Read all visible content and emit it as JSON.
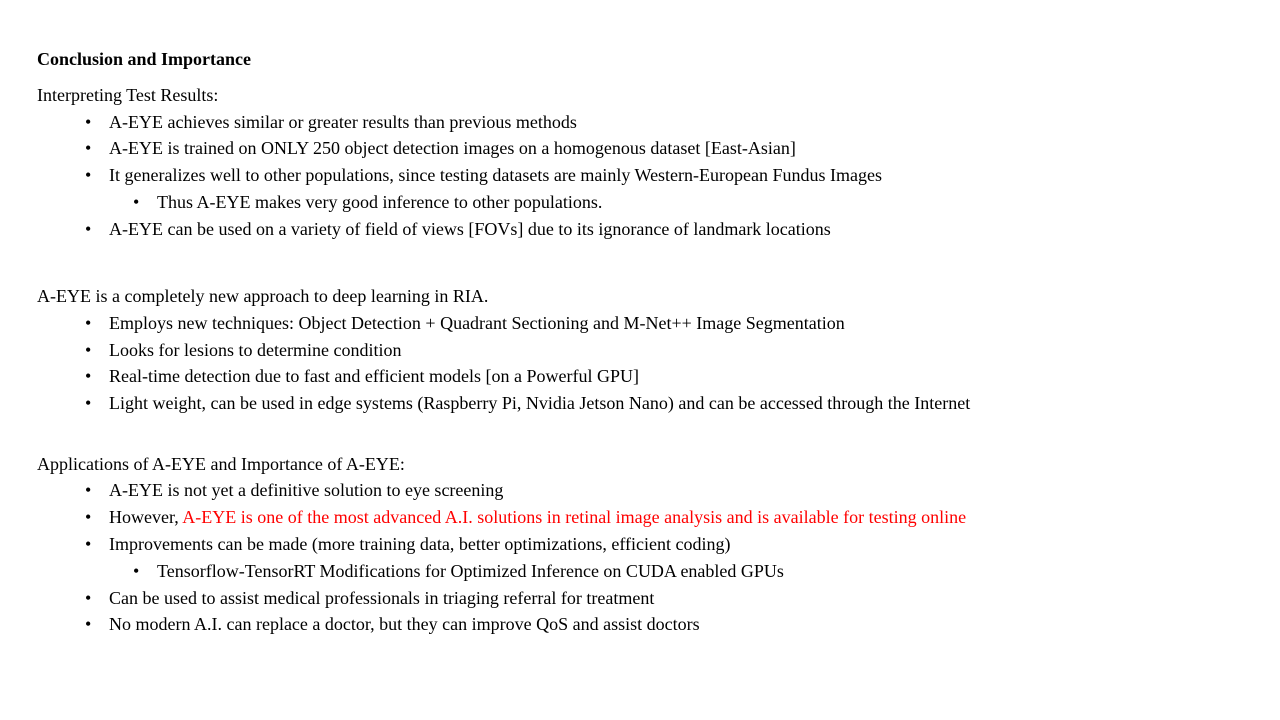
{
  "title": "Conclusion and Importance",
  "sections": [
    {
      "heading": "Interpreting  Test Results:",
      "items": [
        {
          "text": "A-EYE achieves  similar  or greater results than previous methods"
        },
        {
          "text": "A-EYE is trained on ONLY 250 object detection images on a homogenous dataset [East-Asian]"
        },
        {
          "text": "It generalizes  well  to other populations, since testing  datasets are mainly  Western-European Fundus Images"
        },
        {
          "text": "Thus A-EYE makes very good inference to other populations.",
          "sub": true
        },
        {
          "text": "A-EYE can be used on a variety of field of views [FOVs] due to its ignorance of landmark locations"
        }
      ]
    },
    {
      "heading": "A-EYE is a completely new approach to deep learning  in RIA.",
      "items": [
        {
          "text": "Employs new techniques: Object Detection + Quadrant Sectioning and M-Net++ Image Segmentation"
        },
        {
          "text": "Looks for lesions to determine  condition"
        },
        {
          "text": "Real-time  detection due to fast and efficient models [on a Powerful GPU]"
        },
        {
          "text": "Light weight,  can be used in edge systems (Raspberry Pi, Nvidia Jetson Nano) and can be accessed through the Internet"
        }
      ]
    },
    {
      "heading": "Applications of A-EYE and Importance of A-EYE:",
      "items": [
        {
          "text": "A-EYE is not yet a definitive  solution to eye screening"
        },
        {
          "text": "However, ",
          "highlight": "A-EYE is one of the most advanced A.I. solutions in retinal  image analysis and is available  for testing online"
        },
        {
          "text": "Improvements can be made (more training  data, better optimizations,  efficient  coding)"
        },
        {
          "text": "Tensorflow-TensorRT Modifications for Optimized Inference on CUDA enabled GPUs",
          "sub": true
        },
        {
          "text": "Can be used to assist medical professionals in triaging  referral for treatment"
        },
        {
          "text": "No modern A.I. can replace a doctor, but they can improve QoS and assist doctors"
        }
      ]
    }
  ],
  "bullet_char": "•",
  "colors": {
    "text": "#000000",
    "highlight": "#ff0000",
    "background": "#ffffff"
  }
}
